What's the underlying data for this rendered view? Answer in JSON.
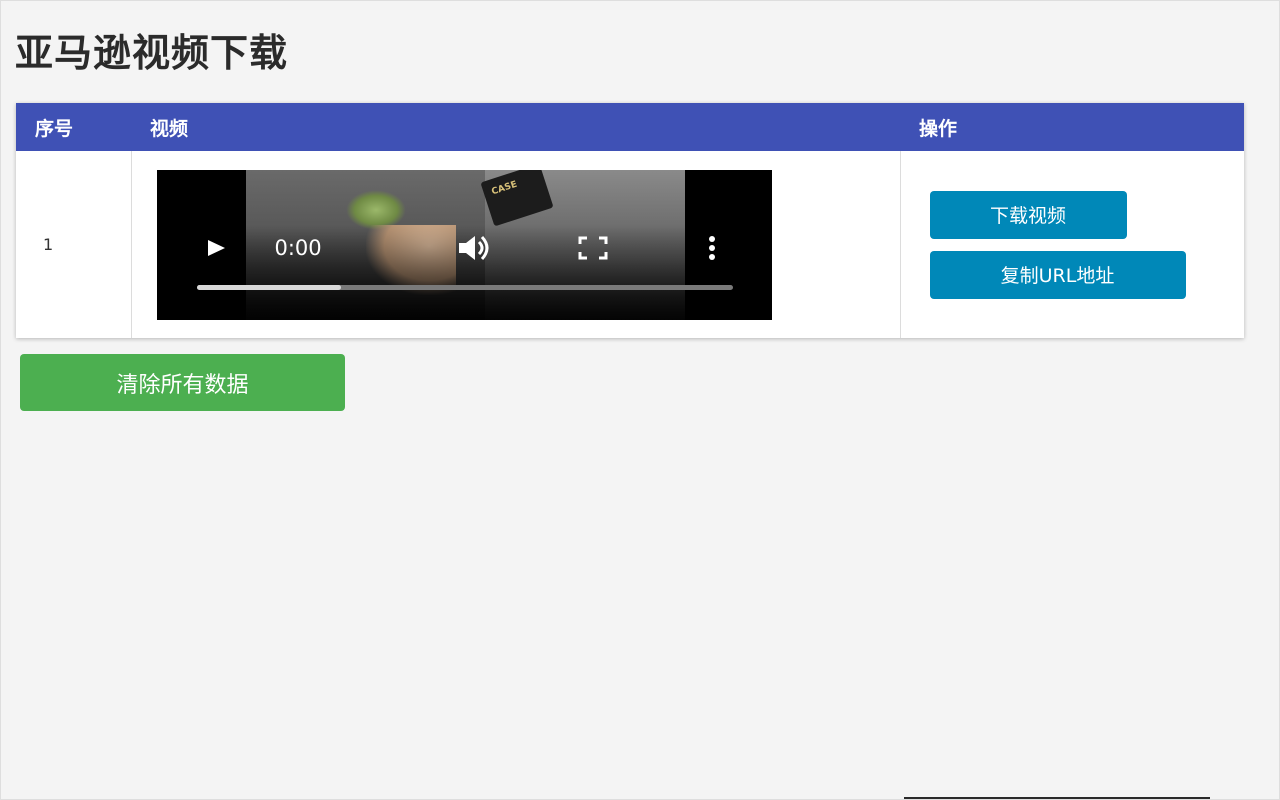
{
  "page": {
    "title": "亚马逊视频下载"
  },
  "table": {
    "headers": {
      "index": "序号",
      "video": "视频",
      "actions": "操作"
    },
    "rows": [
      {
        "index": "1",
        "video": {
          "current_time": "0:00",
          "progress_fraction": 0.27,
          "box_label": "CASE"
        },
        "download_label": "下载视频",
        "copy_label": "复制URL地址"
      }
    ]
  },
  "clear_button": {
    "label": "清除所有数据"
  },
  "colors": {
    "header_bg": "#3f51b5",
    "action_button": "#0088b8",
    "clear_button": "#4caf50",
    "page_bg": "#f4f4f4"
  },
  "icons": {
    "play": "play-icon",
    "volume": "volume-icon",
    "fullscreen": "fullscreen-icon",
    "more": "more-vertical-icon"
  }
}
